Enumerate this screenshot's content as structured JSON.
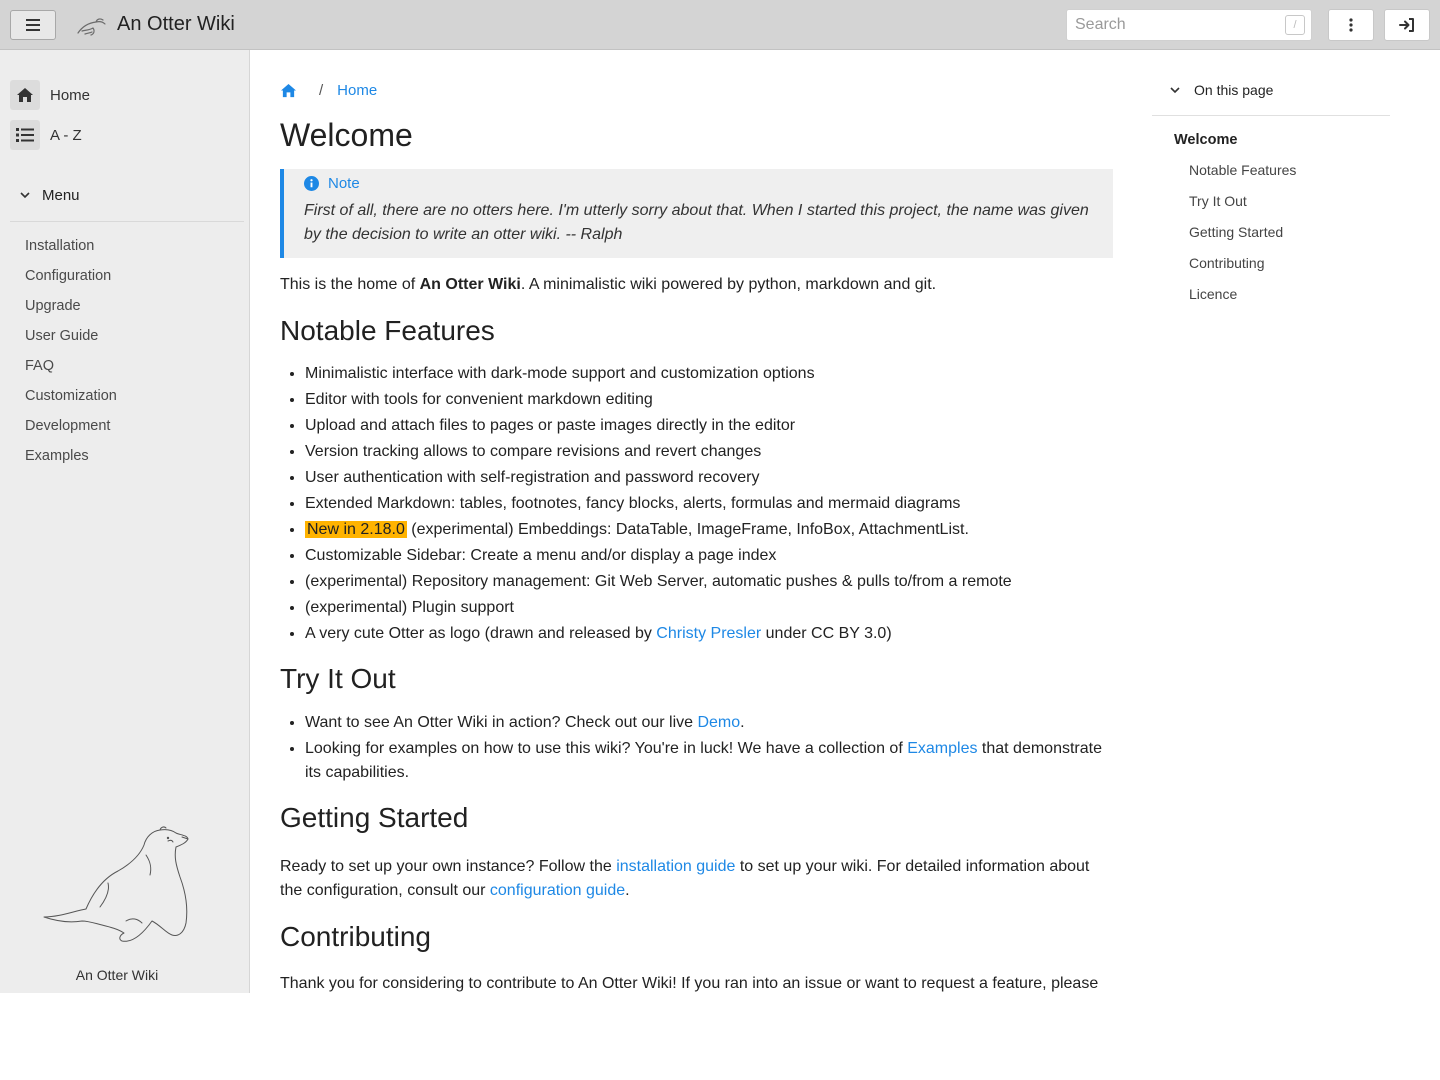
{
  "header": {
    "title": "An Otter Wiki",
    "search_placeholder": "Search",
    "search_shortcut": "/"
  },
  "sidebar": {
    "nav": [
      {
        "label": "Home",
        "icon": "home-icon"
      },
      {
        "label": "A - Z",
        "icon": "list-icon"
      }
    ],
    "menu_label": "Menu",
    "menu_items": [
      "Installation",
      "Configuration",
      "Upgrade",
      "User Guide",
      "FAQ",
      "Customization",
      "Development",
      "Examples"
    ],
    "caption": "An Otter Wiki"
  },
  "breadcrumb": {
    "current": "Home"
  },
  "page": {
    "title": "Welcome",
    "note": {
      "title": "Note",
      "body": "First of all, there are no otters here. I'm utterly sorry about that. When I started this project, the name was given by the decision to write an otter wiki. -- Ralph"
    },
    "intro": {
      "pre": "This is the home of ",
      "bold": "An Otter Wiki",
      "post": ". A minimalistic wiki powered by python, markdown and git."
    },
    "features_heading": "Notable Features",
    "features": [
      "Minimalistic interface with dark-mode support and customization options",
      "Editor with tools for convenient markdown editing",
      "Upload and attach files to pages or paste images directly in the editor",
      "Version tracking allows to compare revisions and revert changes",
      "User authentication with self-registration and password recovery",
      "Extended Markdown: tables, footnotes, fancy blocks, alerts, formulas and mermaid diagrams"
    ],
    "feature_new": {
      "badge": "New in 2.18.0",
      "text": " (experimental) Embeddings: DataTable, ImageFrame, InfoBox, AttachmentList."
    },
    "features_more": [
      "Customizable Sidebar: Create a menu and/or display a page index",
      "(experimental) Repository management: Git Web Server, automatic pushes & pulls to/from a remote",
      "(experimental) Plugin support"
    ],
    "feature_logo": {
      "pre": "A very cute Otter as logo (drawn and released by ",
      "link": "Christy Presler",
      "post": " under CC BY 3.0)"
    },
    "try_heading": "Try It Out",
    "try_items": [
      {
        "pre": "Want to see An Otter Wiki in action? Check out our live ",
        "link": "Demo",
        "post": "."
      },
      {
        "pre": "Looking for examples on how to use this wiki? You're in luck! We have a collection of ",
        "link": "Examples",
        "post": " that demonstrate its capabilities."
      }
    ],
    "getting_started_heading": "Getting Started",
    "getting_started": {
      "pre": "Ready to set up your own instance? Follow the ",
      "link1": "installation guide",
      "mid": " to set up your wiki. For detailed information about the configuration, consult our ",
      "link2": "configuration guide",
      "post": "."
    },
    "contributing_heading": "Contributing",
    "contributing_text": "Thank you for considering to contribute to An Otter Wiki! If you ran into an issue or want to request a feature, please"
  },
  "toc": {
    "title": "On this page",
    "top": "Welcome",
    "items": [
      "Notable Features",
      "Try It Out",
      "Getting Started",
      "Contributing",
      "Licence"
    ]
  },
  "colors": {
    "accent": "#1e88e5",
    "badge": "#ffb300",
    "topbar": "#d4d4d4",
    "sidebar": "#ededed"
  }
}
